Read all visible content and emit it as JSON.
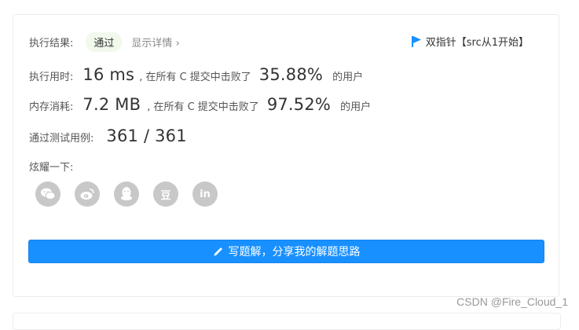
{
  "result": {
    "label": "执行结果:",
    "status": "通过",
    "details": "显示详情",
    "details_chevron": "›"
  },
  "badge": {
    "icon": "flag-icon",
    "text": "双指针【src从1开始】"
  },
  "runtime": {
    "label": "执行用时:",
    "value": "16 ms",
    "mid_text": ", 在所有 C 提交中击败了",
    "percent": "35.88%",
    "suffix": "的用户"
  },
  "memory": {
    "label": "内存消耗:",
    "value": "7.2 MB",
    "mid_text": ", 在所有 C 提交中击败了",
    "percent": "97.52%",
    "suffix": "的用户"
  },
  "testcases": {
    "label": "通过测试用例:",
    "value": "361 / 361"
  },
  "share": {
    "label": "炫耀一下:",
    "items": [
      {
        "icon": "wechat-icon",
        "glyph": ""
      },
      {
        "icon": "weibo-icon",
        "glyph": ""
      },
      {
        "icon": "qq-icon",
        "glyph": ""
      },
      {
        "icon": "douban-icon",
        "glyph": "豆"
      },
      {
        "icon": "linkedin-icon",
        "glyph": "in"
      }
    ]
  },
  "write_button": {
    "label": "写题解，分享我的解题思路"
  },
  "watermark": "CSDN @Fire_Cloud_1",
  "colors": {
    "primary": "#1890ff",
    "success_bg": "#f1f8ec",
    "icon_gray": "#c8c8c8"
  }
}
